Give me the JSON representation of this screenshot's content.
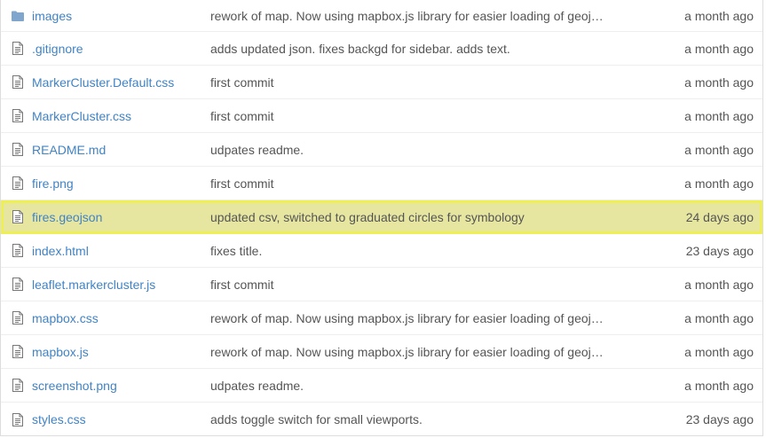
{
  "files": [
    {
      "icon": "folder-icon",
      "name": "images",
      "message": "rework of map. Now using mapbox.js library for easier loading of geoj…",
      "age": "a month ago",
      "highlighted": false
    },
    {
      "icon": "file-icon",
      "name": ".gitignore",
      "message": "adds updated json. fixes backgd for sidebar. adds text.",
      "age": "a month ago",
      "highlighted": false
    },
    {
      "icon": "file-icon",
      "name": "MarkerCluster.Default.css",
      "message": "first commit",
      "age": "a month ago",
      "highlighted": false
    },
    {
      "icon": "file-icon",
      "name": "MarkerCluster.css",
      "message": "first commit",
      "age": "a month ago",
      "highlighted": false
    },
    {
      "icon": "file-icon",
      "name": "README.md",
      "message": "udpates readme.",
      "age": "a month ago",
      "highlighted": false
    },
    {
      "icon": "file-icon",
      "name": "fire.png",
      "message": "first commit",
      "age": "a month ago",
      "highlighted": false
    },
    {
      "icon": "file-icon",
      "name": "fires.geojson",
      "message": "updated csv, switched to graduated circles for symbology",
      "age": "24 days ago",
      "highlighted": true
    },
    {
      "icon": "file-icon",
      "name": "index.html",
      "message": "fixes title.",
      "age": "23 days ago",
      "highlighted": false
    },
    {
      "icon": "file-icon",
      "name": "leaflet.markercluster.js",
      "message": "first commit",
      "age": "a month ago",
      "highlighted": false
    },
    {
      "icon": "file-icon",
      "name": "mapbox.css",
      "message": "rework of map. Now using mapbox.js library for easier loading of geoj…",
      "age": "a month ago",
      "highlighted": false
    },
    {
      "icon": "file-icon",
      "name": "mapbox.js",
      "message": "rework of map. Now using mapbox.js library for easier loading of geoj…",
      "age": "a month ago",
      "highlighted": false
    },
    {
      "icon": "file-icon",
      "name": "screenshot.png",
      "message": "udpates readme.",
      "age": "a month ago",
      "highlighted": false
    },
    {
      "icon": "file-icon",
      "name": "styles.css",
      "message": "adds toggle switch for small viewports.",
      "age": "23 days ago",
      "highlighted": false
    }
  ],
  "colors": {
    "link": "#4183c4",
    "text": "#555555",
    "highlight_bg": "#e6e6a1",
    "highlight_border": "#eeee55",
    "folder": "#80a6cd",
    "file_icon": "#777777"
  }
}
